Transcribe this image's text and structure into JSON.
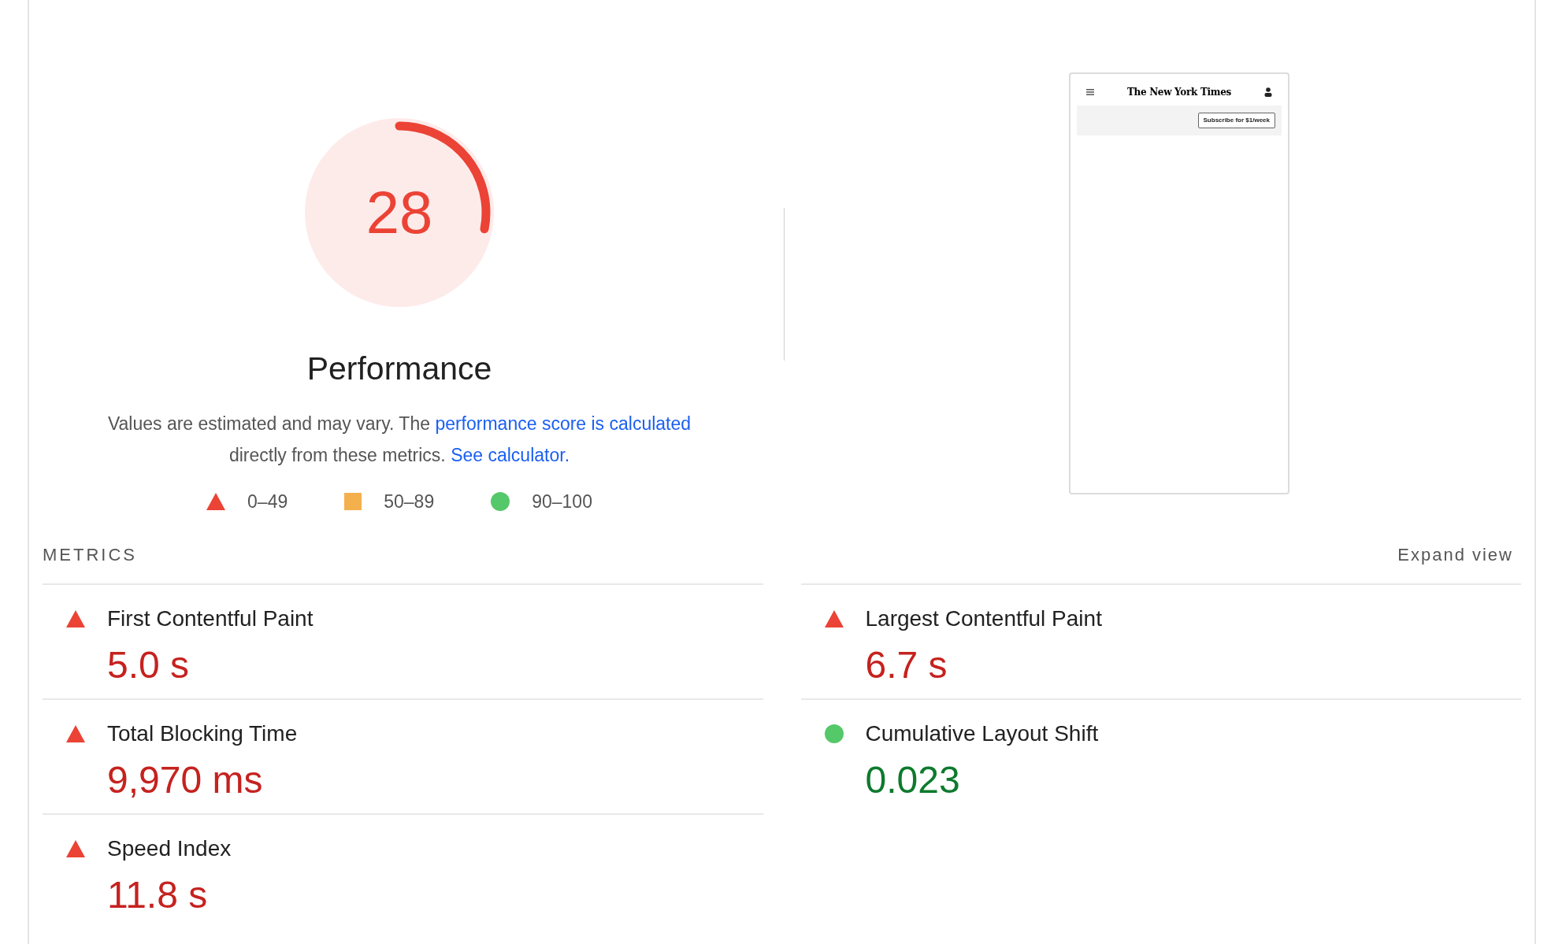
{
  "gauge": {
    "score": "28",
    "level": 0.28,
    "title": "Performance"
  },
  "description": [
    {
      "text": "Values are estimated and may vary. The ",
      "link": false
    },
    {
      "text": "performance score is calculated",
      "link": true
    },
    {
      "text": " directly from these metrics. ",
      "link": false
    },
    {
      "text": "See calculator.",
      "link": true
    }
  ],
  "legend": [
    {
      "kind": "fail",
      "label": "0–49"
    },
    {
      "kind": "average",
      "label": "50–89"
    },
    {
      "kind": "pass",
      "label": "90–100"
    }
  ],
  "thumbnail": {
    "logo": "The New York Times",
    "button": "Subscribe for $1/week"
  },
  "metrics_header": {
    "title": "METRICS",
    "expand": "Expand view"
  },
  "metrics": [
    {
      "name": "First Contentful Paint",
      "value": "5.0 s",
      "kind": "fail"
    },
    {
      "name": "Largest Contentful Paint",
      "value": "6.7 s",
      "kind": "fail"
    },
    {
      "name": "Total Blocking Time",
      "value": "9,970 ms",
      "kind": "fail"
    },
    {
      "name": "Cumulative Layout Shift",
      "value": "0.023",
      "kind": "pass"
    },
    {
      "name": "Speed Index",
      "value": "11.8 s",
      "kind": "fail"
    }
  ]
}
